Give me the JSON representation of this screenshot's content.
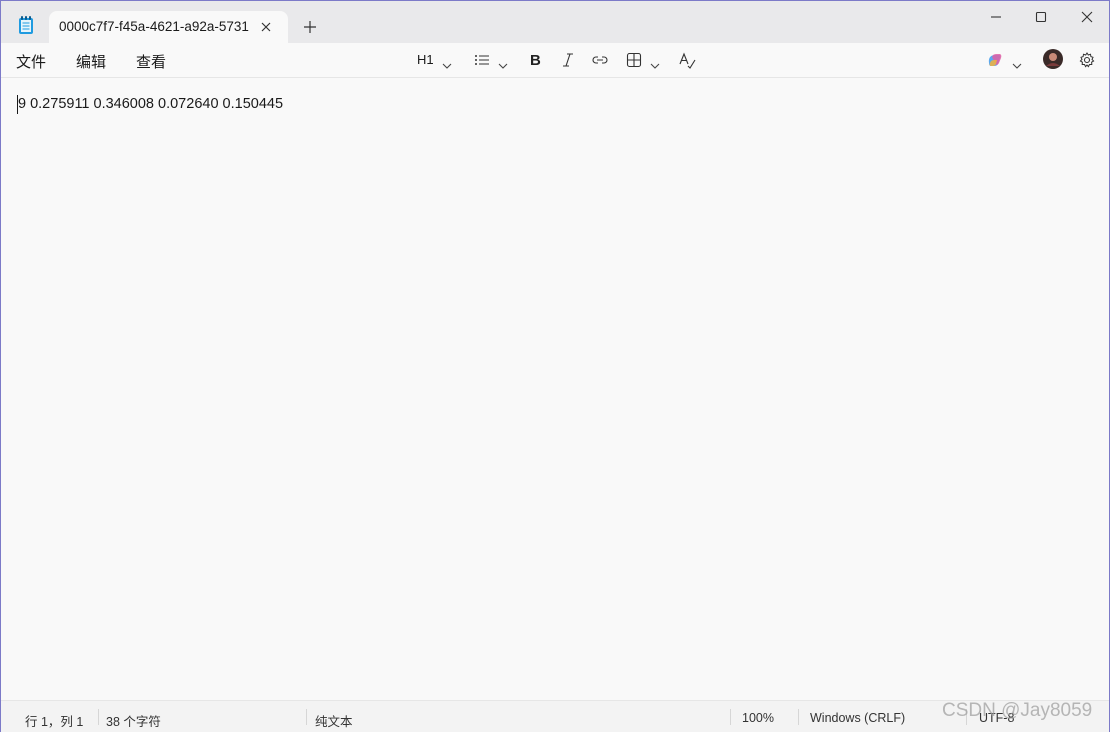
{
  "tab": {
    "title": "0000c7f7-f45a-4621-a92a-5731"
  },
  "menu": {
    "file": "文件",
    "edit": "编辑",
    "view": "查看"
  },
  "toolbar": {
    "heading": "H1",
    "icons": [
      "list-icon",
      "bold-icon",
      "italic-icon",
      "link-icon",
      "table-icon",
      "spellcheck-icon",
      "copilot-icon",
      "avatar",
      "gear-icon"
    ]
  },
  "document": {
    "content": "9 0.275911 0.346008 0.072640 0.150445"
  },
  "status": {
    "position": "行 1，列 1",
    "char_count": "38 个字符",
    "format": "纯文本",
    "zoom": "100%",
    "line_ending": "Windows (CRLF)",
    "encoding": "UTF-8"
  },
  "watermark": "CSDN @Jay8059",
  "colors": {
    "window_border": "#7c7ac8",
    "titlebar_bg": "#e9e9eb",
    "editor_bg": "#f9f9f9"
  }
}
